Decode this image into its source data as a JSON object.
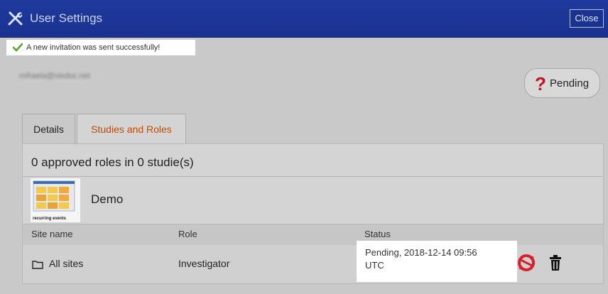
{
  "window": {
    "title": "User Settings",
    "close_label": "Close",
    "accent_color": "#1f3a9e"
  },
  "notice": {
    "message": "A new invitation was sent successfully!"
  },
  "user": {
    "email": "mihaela@viedoc.net",
    "status_label": "Pending",
    "status_icon": "question-mark-icon"
  },
  "tabs": [
    {
      "label": "Details",
      "active": false
    },
    {
      "label": "Studies and Roles",
      "active": true
    }
  ],
  "roles_summary": "0 approved roles in 0 studie(s)",
  "study": {
    "thumbnail_caption": "recurring events",
    "name": "Demo"
  },
  "table": {
    "columns": [
      "Site name",
      "Role",
      "Status"
    ],
    "rows": [
      {
        "site": "All sites",
        "role": "Investigator",
        "status_line1": "Pending, 2018-12-14 09:56",
        "status_line2": "UTC"
      }
    ]
  }
}
